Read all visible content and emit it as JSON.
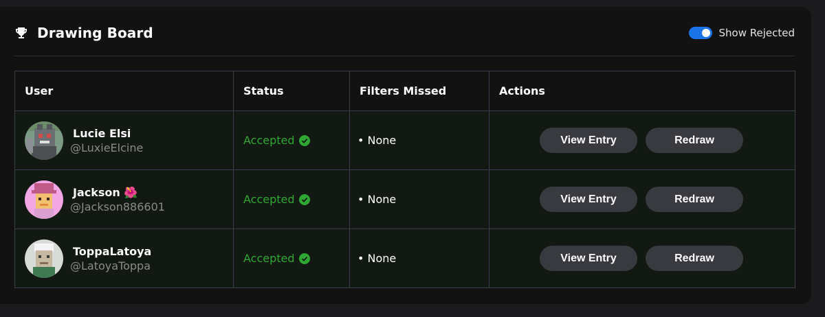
{
  "header": {
    "title": "Drawing Board",
    "toggle_label": "Show Rejected",
    "toggle_on": true
  },
  "table": {
    "columns": [
      "User",
      "Status",
      "Filters Missed",
      "Actions"
    ],
    "rows": [
      {
        "name": "Lucie Elsi",
        "handle": "@LuxieElcine",
        "status": "Accepted",
        "filters": "• None",
        "view_label": "View Entry",
        "redraw_label": "Redraw"
      },
      {
        "name": "Jackson 🌺",
        "handle": "@Jackson886601",
        "status": "Accepted",
        "filters": "• None",
        "view_label": "View Entry",
        "redraw_label": "Redraw"
      },
      {
        "name": "ToppaLatoya",
        "handle": "@LatoyaToppa",
        "status": "Accepted",
        "filters": "• None",
        "view_label": "View Entry",
        "redraw_label": "Redraw"
      }
    ]
  },
  "icons": {
    "title": "trophy-icon",
    "status": "check-circle-icon"
  },
  "colors": {
    "accent": "#1b73e8",
    "accepted": "#2fa833",
    "button_bg": "#383a40"
  }
}
